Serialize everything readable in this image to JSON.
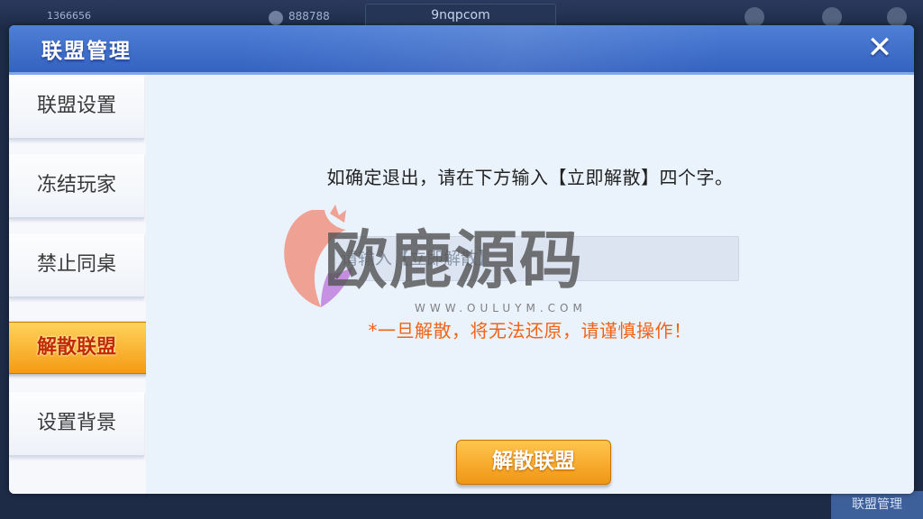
{
  "background": {
    "user_id": "1366656",
    "coins": "888788",
    "room_label": "9nqpcom",
    "corner_button": "联盟管理"
  },
  "dialog": {
    "title": "联盟管理",
    "close_icon": "close-icon"
  },
  "sidebar": {
    "items": [
      {
        "label": "联盟设置",
        "active": false
      },
      {
        "label": "冻结玩家",
        "active": false
      },
      {
        "label": "禁止同桌",
        "active": false
      },
      {
        "label": "解散联盟",
        "active": true
      },
      {
        "label": "设置背景",
        "active": false
      }
    ]
  },
  "content": {
    "instruction": "如确定退出，请在下方输入【立即解散】四个字。",
    "input": {
      "value": "",
      "placeholder": "请输入【立即解散】"
    },
    "warning": "*一旦解散，将无法还原，请谨慎操作！",
    "dissolve_button": "解散联盟"
  },
  "watermark": {
    "text": "欧鹿源码",
    "sub": "WWW.OULUYM.COM"
  },
  "colors": {
    "header": "#3f6fcf",
    "active_tab": "#f8a820",
    "warning": "#f06418",
    "button": "#f5a41e"
  }
}
